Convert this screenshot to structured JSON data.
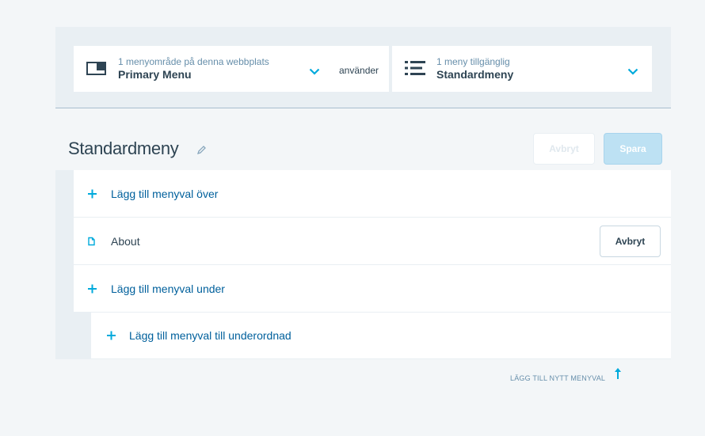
{
  "location_selector": {
    "subtitle": "1 menyområde på denna webbplats",
    "title": "Primary Menu",
    "icon": "layout-icon"
  },
  "uses_label": "använder",
  "menu_selector": {
    "subtitle": "1 meny tillgänglig",
    "title": "Standardmeny",
    "icon": "list-icon"
  },
  "menu": {
    "name": "Standardmeny",
    "cancel_label": "Avbryt",
    "save_label": "Spara"
  },
  "rows": {
    "add_above": "Lägg till menyval över",
    "item_label": "About",
    "item_cancel": "Avbryt",
    "add_below": "Lägg till menyval under",
    "add_child": "Lägg till menyval till underordnad"
  },
  "add_new_item": "LÄGG TILL NYTT MENYVAL",
  "colors": {
    "accent": "#00aadc",
    "link": "#00609c",
    "text": "#2e4453",
    "save_disabled": "#bde1f3"
  }
}
